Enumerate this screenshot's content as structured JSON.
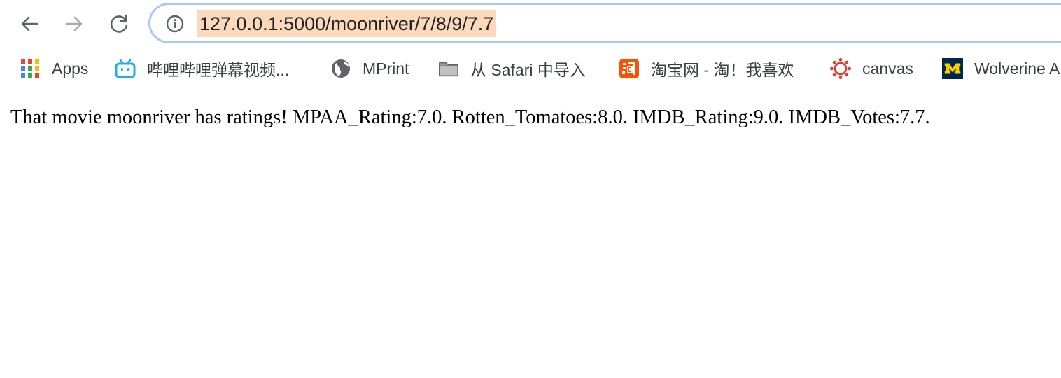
{
  "browser": {
    "url": "127.0.0.1:5000/moonriver/7/8/9/7.7",
    "nav": {
      "back_icon": "arrow-left-icon",
      "forward_icon": "arrow-right-icon",
      "reload_icon": "reload-icon",
      "info_icon": "info-icon"
    },
    "bookmarks": [
      {
        "label": "Apps",
        "icon": "apps-grid-icon"
      },
      {
        "label": "哔哩哔哩弹幕视频...",
        "icon": "bilibili-tv-icon"
      },
      {
        "label": "MPrint",
        "icon": "globe-icon"
      },
      {
        "label": "从 Safari 中导入",
        "icon": "folder-icon"
      },
      {
        "label": "淘宝网 - 淘！我喜欢",
        "icon": "taobao-icon"
      },
      {
        "label": "canvas",
        "icon": "canvas-icon"
      },
      {
        "label": "Wolverine A",
        "icon": "block-m-icon"
      }
    ]
  },
  "page": {
    "message": "That movie moonriver has ratings! MPAA_Rating:7.0. Rotten_Tomatoes:8.0. IMDB_Rating:9.0. IMDB_Votes:7.7."
  },
  "colors": {
    "omnibox_border": "#a8c7fa",
    "url_highlight": "#fdd9bb",
    "bilibili": "#23ade5",
    "taobao": "#ff5000",
    "canvas": "#e13f2b",
    "michigan_blue": "#00274c",
    "michigan_maize": "#ffcb05"
  }
}
